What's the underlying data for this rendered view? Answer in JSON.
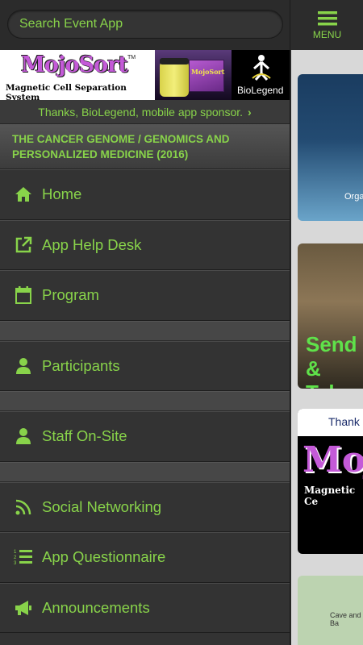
{
  "search": {
    "placeholder": "Search Event App"
  },
  "menu": {
    "label": "MENU"
  },
  "sponsor": {
    "logo_text": "MojoSort",
    "tm": "TM",
    "subtitle": "Magnetic Cell Separation System",
    "product_text": "MojoSort",
    "brand": "BioLegend",
    "thanks": "Thanks, BioLegend, mobile app sponsor."
  },
  "event": {
    "title": "THE CANCER GENOME / GENOMICS AND PERSONALIZED MEDICINE (2016)"
  },
  "nav": {
    "items": [
      {
        "label": "Home",
        "icon": "home-icon"
      },
      {
        "label": "App Help Desk",
        "icon": "external-link-icon"
      },
      {
        "label": "Program",
        "icon": "calendar-icon"
      },
      {
        "label": "Participants",
        "icon": "person-icon"
      },
      {
        "label": "Staff On-Site",
        "icon": "person-icon"
      },
      {
        "label": "Social Networking",
        "icon": "rss-icon"
      },
      {
        "label": "App Questionnaire",
        "icon": "numbered-list-icon"
      },
      {
        "label": "Announcements",
        "icon": "megaphone-icon"
      }
    ]
  },
  "content": {
    "card1_caption": "Orga",
    "card2_text": "Send I & Take",
    "card3_header": "Thank",
    "card3_logo": "Mojo",
    "card3_sub": "Magnetic Ce",
    "card4_caption": "Cave and Ba"
  },
  "colors": {
    "accent": "#88d34a",
    "sidebar_bg": "#333333",
    "content_bg": "#d8d8d8"
  }
}
